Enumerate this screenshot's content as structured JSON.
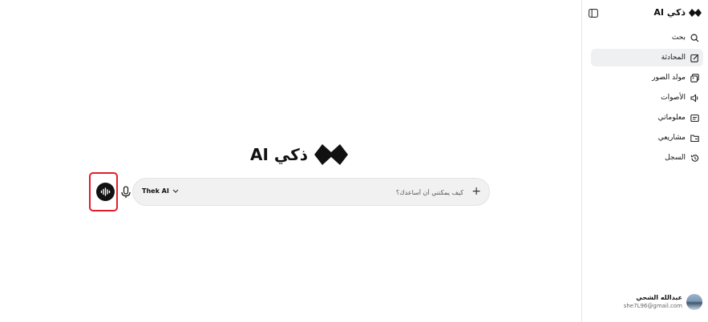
{
  "brand": {
    "name": "ذكي AI"
  },
  "sidebar": {
    "items": [
      {
        "label": "بحث",
        "icon": "search-icon"
      },
      {
        "label": "المحادثة",
        "icon": "edit-icon",
        "active": true
      },
      {
        "label": "مولد الصور",
        "icon": "image-icon"
      },
      {
        "label": "الأصوات",
        "icon": "speaker-icon"
      },
      {
        "label": "معلوماتي",
        "icon": "info-card-icon"
      },
      {
        "label": "مشاريعي",
        "icon": "folder-icon"
      },
      {
        "label": "السجل",
        "icon": "history-icon"
      }
    ]
  },
  "user": {
    "name": "عبدالله الشحي",
    "email": "she7L96@gmail.com"
  },
  "hero": {
    "title": "ذكي AI"
  },
  "chat": {
    "placeholder": "كيف يمكنني أن أساعدك؟",
    "model_label": "Thek AI"
  },
  "colors": {
    "highlight": "#e11d2a",
    "accent_dark": "#111111",
    "active_bg": "#eef0f2"
  }
}
